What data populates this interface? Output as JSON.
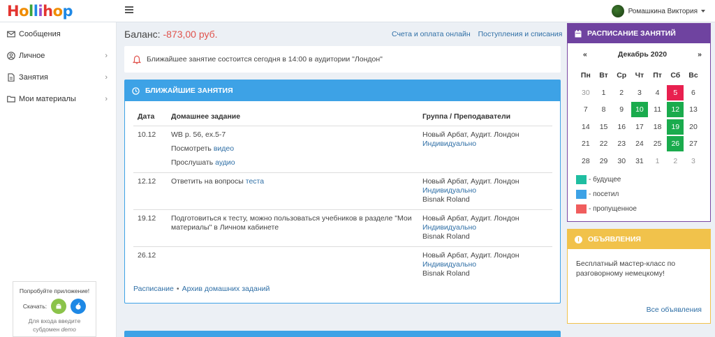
{
  "app": {
    "logo_letters": [
      "H",
      "o",
      "l",
      "l",
      "i",
      "h",
      "o",
      "p"
    ],
    "logo_colors": [
      "#e3342f",
      "#f08c00",
      "#3aa33a",
      "#1e88e5",
      "#9b4dca",
      "#e3342f",
      "#f08c00",
      "#1e88e5"
    ]
  },
  "topbar": {
    "menu_icon": "hamburger-icon",
    "user_name": "Ромашкина Виктория"
  },
  "sidebar": {
    "items": [
      {
        "label": "Сообщения",
        "icon": "envelope-icon",
        "has_chevron": false
      },
      {
        "label": "Личное",
        "icon": "user-circle-icon",
        "has_chevron": true
      },
      {
        "label": "Занятия",
        "icon": "document-icon",
        "has_chevron": true
      },
      {
        "label": "Мои материалы",
        "icon": "folder-icon",
        "has_chevron": true
      }
    ],
    "promo": {
      "title": "Попробуйте приложение!",
      "download_label": "Скачать:",
      "hint_line1": "Для входа введите",
      "hint_line2_prefix": "субдомен",
      "hint_line2_value": "demo"
    }
  },
  "header": {
    "balance_label": "Баланс:",
    "balance_value": "-873,00 руб.",
    "links": [
      "Счета и оплата онлайн",
      "Поступления и списания"
    ]
  },
  "alert": {
    "text": "Ближайшее занятие состоится сегодня в 14:00 в аудитории \"Лондон\""
  },
  "lessons": {
    "title": "Ближайшие занятия",
    "columns": [
      "Дата",
      "Домашнее задание",
      "Группа / Преподаватели"
    ],
    "rows": [
      {
        "date": "10.12",
        "hw_main": "WB p. 56, ex.5-7",
        "hw_extra": [
          {
            "prefix": "Посмотреть",
            "link": "видео"
          },
          {
            "prefix": "Прослушать",
            "link": "аудио"
          }
        ],
        "group": "Новый Арбат, Аудит. Лондон",
        "type": "Индивидуально",
        "teacher": ""
      },
      {
        "date": "12.12",
        "hw_main": "Ответить на вопросы",
        "hw_link": "теста",
        "group": "Новый Арбат, Аудит. Лондон",
        "type": "Индивидуально",
        "teacher": "Bisnak Roland"
      },
      {
        "date": "19.12",
        "hw_main": "Подготовиться к тесту, можно пользоваться учебников в разделе \"Мои материалы\" в Личном кабинете",
        "group": "Новый Арбат, Аудит. Лондон",
        "type": "Индивидуально",
        "teacher": "Bisnak Roland"
      },
      {
        "date": "26.12",
        "hw_main": "",
        "group": "Новый Арбат, Аудит. Лондон",
        "type": "Индивидуально",
        "teacher": "Bisnak Roland"
      }
    ],
    "footer_links": [
      "Расписание",
      "Архив домашних заданий"
    ],
    "footer_separator": "•"
  },
  "schedule": {
    "title": "Расписание занятий",
    "prev": "«",
    "next": "»",
    "month": "Декабрь 2020",
    "weekdays": [
      "Пн",
      "Вт",
      "Ср",
      "Чт",
      "Пт",
      "Сб",
      "Вс"
    ],
    "weeks": [
      [
        {
          "d": "30",
          "s": "muted"
        },
        {
          "d": "1"
        },
        {
          "d": "2"
        },
        {
          "d": "3"
        },
        {
          "d": "4"
        },
        {
          "d": "5",
          "s": "missed"
        },
        {
          "d": "6"
        }
      ],
      [
        {
          "d": "7"
        },
        {
          "d": "8"
        },
        {
          "d": "9"
        },
        {
          "d": "10",
          "s": "future"
        },
        {
          "d": "11"
        },
        {
          "d": "12",
          "s": "future"
        },
        {
          "d": "13"
        }
      ],
      [
        {
          "d": "14"
        },
        {
          "d": "15"
        },
        {
          "d": "16"
        },
        {
          "d": "17"
        },
        {
          "d": "18"
        },
        {
          "d": "19",
          "s": "future"
        },
        {
          "d": "20"
        }
      ],
      [
        {
          "d": "21"
        },
        {
          "d": "22"
        },
        {
          "d": "23"
        },
        {
          "d": "24"
        },
        {
          "d": "25"
        },
        {
          "d": "26",
          "s": "future"
        },
        {
          "d": "27"
        }
      ],
      [
        {
          "d": "28"
        },
        {
          "d": "29"
        },
        {
          "d": "30"
        },
        {
          "d": "31"
        },
        {
          "d": "1",
          "s": "muted"
        },
        {
          "d": "2",
          "s": "muted"
        },
        {
          "d": "3",
          "s": "muted"
        }
      ]
    ],
    "status_colors": {
      "future": "#1aab4d",
      "missed": "#e8204f"
    },
    "legend": [
      {
        "label": "- будущее",
        "color": "#1fbea1"
      },
      {
        "label": "- посетил",
        "color": "#3da2e6"
      },
      {
        "label": "- пропущенное",
        "color": "#f05d5d"
      }
    ]
  },
  "announcements": {
    "title": "Объявления",
    "text": "Бесплатный мастер-класс по разговорному немецкому!",
    "all_link": "Все объявления"
  }
}
